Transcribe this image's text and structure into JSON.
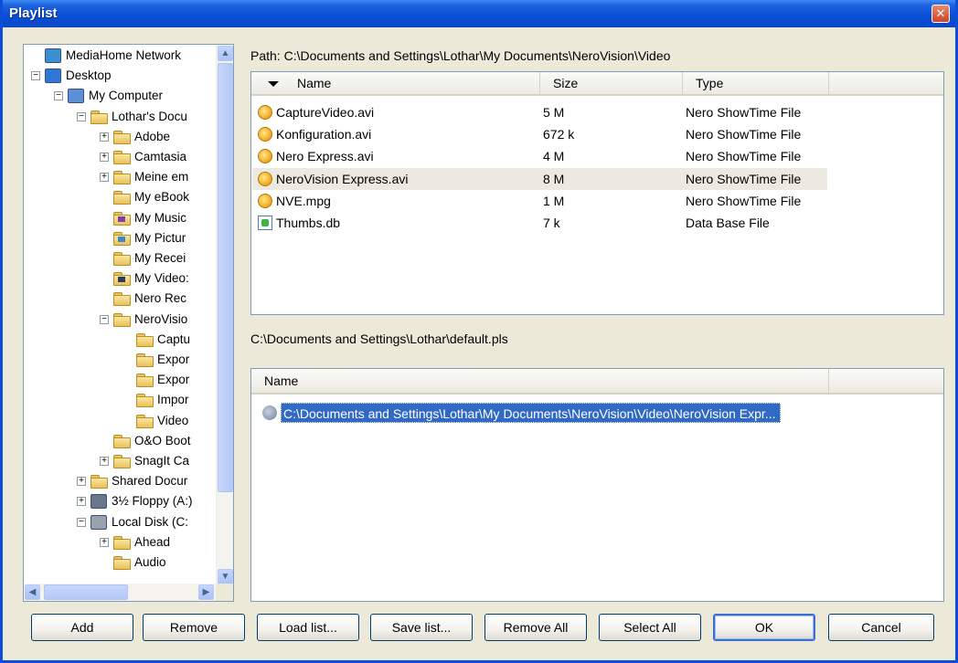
{
  "window": {
    "title": "Playlist",
    "close_glyph": "✕"
  },
  "tree": {
    "items": [
      {
        "label": "MediaHome Network",
        "icon": "network-icon",
        "depth": 0,
        "expander": ""
      },
      {
        "label": "Desktop",
        "icon": "desktop-icon",
        "depth": 0,
        "expander": "−"
      },
      {
        "label": "My Computer",
        "icon": "computer-icon",
        "depth": 1,
        "expander": "−"
      },
      {
        "label": "Lothar's Docu",
        "icon": "folder-icon",
        "depth": 2,
        "expander": "−"
      },
      {
        "label": "Adobe",
        "icon": "folder-icon",
        "depth": 3,
        "expander": "+"
      },
      {
        "label": "Camtasia",
        "icon": "folder-icon",
        "depth": 3,
        "expander": "+"
      },
      {
        "label": "Meine em",
        "icon": "folder-icon",
        "depth": 3,
        "expander": "+"
      },
      {
        "label": "My eBook",
        "icon": "folder-icon",
        "depth": 3,
        "expander": ""
      },
      {
        "label": "My Music",
        "icon": "music-folder-icon",
        "depth": 3,
        "expander": ""
      },
      {
        "label": "My Pictur",
        "icon": "pictures-folder-icon",
        "depth": 3,
        "expander": ""
      },
      {
        "label": "My Recei",
        "icon": "folder-icon",
        "depth": 3,
        "expander": ""
      },
      {
        "label": "My Video:",
        "icon": "videos-folder-icon",
        "depth": 3,
        "expander": ""
      },
      {
        "label": "Nero Rec",
        "icon": "folder-icon",
        "depth": 3,
        "expander": ""
      },
      {
        "label": "NeroVisio",
        "icon": "folder-icon",
        "depth": 3,
        "expander": "−"
      },
      {
        "label": "Captu",
        "icon": "folder-icon",
        "depth": 4,
        "expander": ""
      },
      {
        "label": "Expor",
        "icon": "folder-icon",
        "depth": 4,
        "expander": ""
      },
      {
        "label": "Expor",
        "icon": "folder-icon",
        "depth": 4,
        "expander": ""
      },
      {
        "label": "Impor",
        "icon": "folder-icon",
        "depth": 4,
        "expander": ""
      },
      {
        "label": "Video",
        "icon": "folder-icon",
        "depth": 4,
        "expander": ""
      },
      {
        "label": "O&O Boot",
        "icon": "folder-icon",
        "depth": 3,
        "expander": ""
      },
      {
        "label": "SnagIt Ca",
        "icon": "folder-icon",
        "depth": 3,
        "expander": "+"
      },
      {
        "label": "Shared Docur",
        "icon": "folder-icon",
        "depth": 2,
        "expander": "+"
      },
      {
        "label": "3½ Floppy (A:)",
        "icon": "floppy-icon",
        "depth": 2,
        "expander": "+"
      },
      {
        "label": "Local Disk (C:",
        "icon": "disk-icon",
        "depth": 2,
        "expander": "−"
      },
      {
        "label": "Ahead",
        "icon": "folder-icon",
        "depth": 3,
        "expander": "+"
      },
      {
        "label": "Audio",
        "icon": "folder-icon",
        "depth": 3,
        "expander": ""
      }
    ],
    "scroll_up_glyph": "▲",
    "scroll_down_glyph": "▼",
    "scroll_left_glyph": "◀",
    "scroll_right_glyph": "▶"
  },
  "files": {
    "path_label": "Path: C:\\Documents and Settings\\Lothar\\My Documents\\NeroVision\\Video",
    "columns": {
      "name": "Name",
      "size": "Size",
      "type": "Type"
    },
    "rows": [
      {
        "name": "CaptureVideo.avi",
        "size": "5 M",
        "type": "Nero ShowTime File",
        "icon": "nero-file-icon",
        "selected": false
      },
      {
        "name": "Konfiguration.avi",
        "size": "672 k",
        "type": "Nero ShowTime File",
        "icon": "nero-file-icon",
        "selected": false
      },
      {
        "name": "Nero Express.avi",
        "size": "4 M",
        "type": "Nero ShowTime File",
        "icon": "nero-file-icon",
        "selected": false
      },
      {
        "name": "NeroVision Express.avi",
        "size": "8 M",
        "type": "Nero ShowTime File",
        "icon": "nero-file-icon",
        "selected": true
      },
      {
        "name": "NVE.mpg",
        "size": "1 M",
        "type": "Nero ShowTime File",
        "icon": "nero-file-icon",
        "selected": false
      },
      {
        "name": "Thumbs.db",
        "size": "7 k",
        "type": "Data Base File",
        "icon": "database-file-icon",
        "selected": false
      }
    ]
  },
  "playlist": {
    "file_label": "C:\\Documents and Settings\\Lothar\\default.pls",
    "column_name": "Name",
    "entries": [
      {
        "text": "C:\\Documents and Settings\\Lothar\\My Documents\\NeroVision\\Video\\NeroVision Expr..."
      }
    ]
  },
  "buttons": {
    "add": "Add",
    "remove": "Remove",
    "load_list": "Load list...",
    "save_list": "Save list...",
    "remove_all": "Remove All",
    "select_all": "Select All",
    "ok": "OK",
    "cancel": "Cancel"
  }
}
